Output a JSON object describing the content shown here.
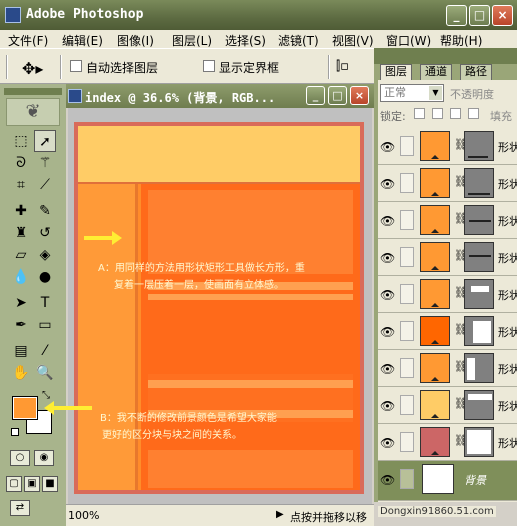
{
  "app": {
    "title": "Adobe Photoshop",
    "window_controls": {
      "minimize": "_",
      "maximize": "□",
      "close": "×"
    }
  },
  "menu": [
    "文件(F)",
    "编辑(E)",
    "图像(I)",
    "图层(L)",
    "选择(S)",
    "滤镜(T)",
    "视图(V)",
    "窗口(W)",
    "帮助(H)"
  ],
  "options_bar": {
    "tool_icon": "move-tool-icon",
    "auto_select_layer": {
      "label": "自动选择图层",
      "checked": false
    },
    "show_bounding_box": {
      "label": "显示定界框",
      "checked": false
    }
  },
  "document": {
    "title": "index @ 36.6% (背景, RGB...",
    "zoom": "100%",
    "status_text": "点按并拖移以移",
    "notes": {
      "a_line1": "A：用同样的方法用形状矩形工具做长方形，重",
      "a_line2": "复着一层压着一层，使画面有立体感。",
      "b_line1": "B：我不断的修改前景颜色是希望大家能",
      "b_line2": "更好的区分块与块之间的关系。"
    }
  },
  "toolbox": {
    "foreground_color": "#ff9933",
    "background_color": "#ffffff"
  },
  "layers_panel": {
    "tabs": [
      {
        "label": "图层",
        "active": true
      },
      {
        "label": "通道",
        "active": false
      },
      {
        "label": "路径",
        "active": false
      }
    ],
    "blend_mode": "正常",
    "opacity_label": "不透明度",
    "lock_label": "锁定:",
    "fill_label": "填充",
    "layers": [
      {
        "name": "形状",
        "thumb_color": "#ff9933"
      },
      {
        "name": "形状",
        "thumb_color": "#ff9933"
      },
      {
        "name": "形状",
        "thumb_color": "#ff9933"
      },
      {
        "name": "形状",
        "thumb_color": "#ff9933"
      },
      {
        "name": "形状",
        "thumb_color": "#ff9933"
      },
      {
        "name": "形状",
        "thumb_color": "#ff6600"
      },
      {
        "name": "形状",
        "thumb_color": "#ff9933"
      },
      {
        "name": "形状",
        "thumb_color": "#ffcc66"
      },
      {
        "name": "形状",
        "thumb_color": "#cc6666"
      }
    ],
    "background_layer": {
      "name": "背景"
    }
  },
  "watermark": "Dongxin91860.51.com",
  "colors": {
    "title_bar": "#5d6b42",
    "accent_orange": "#ff8c2a",
    "arrow_yellow": "#ffee33"
  }
}
